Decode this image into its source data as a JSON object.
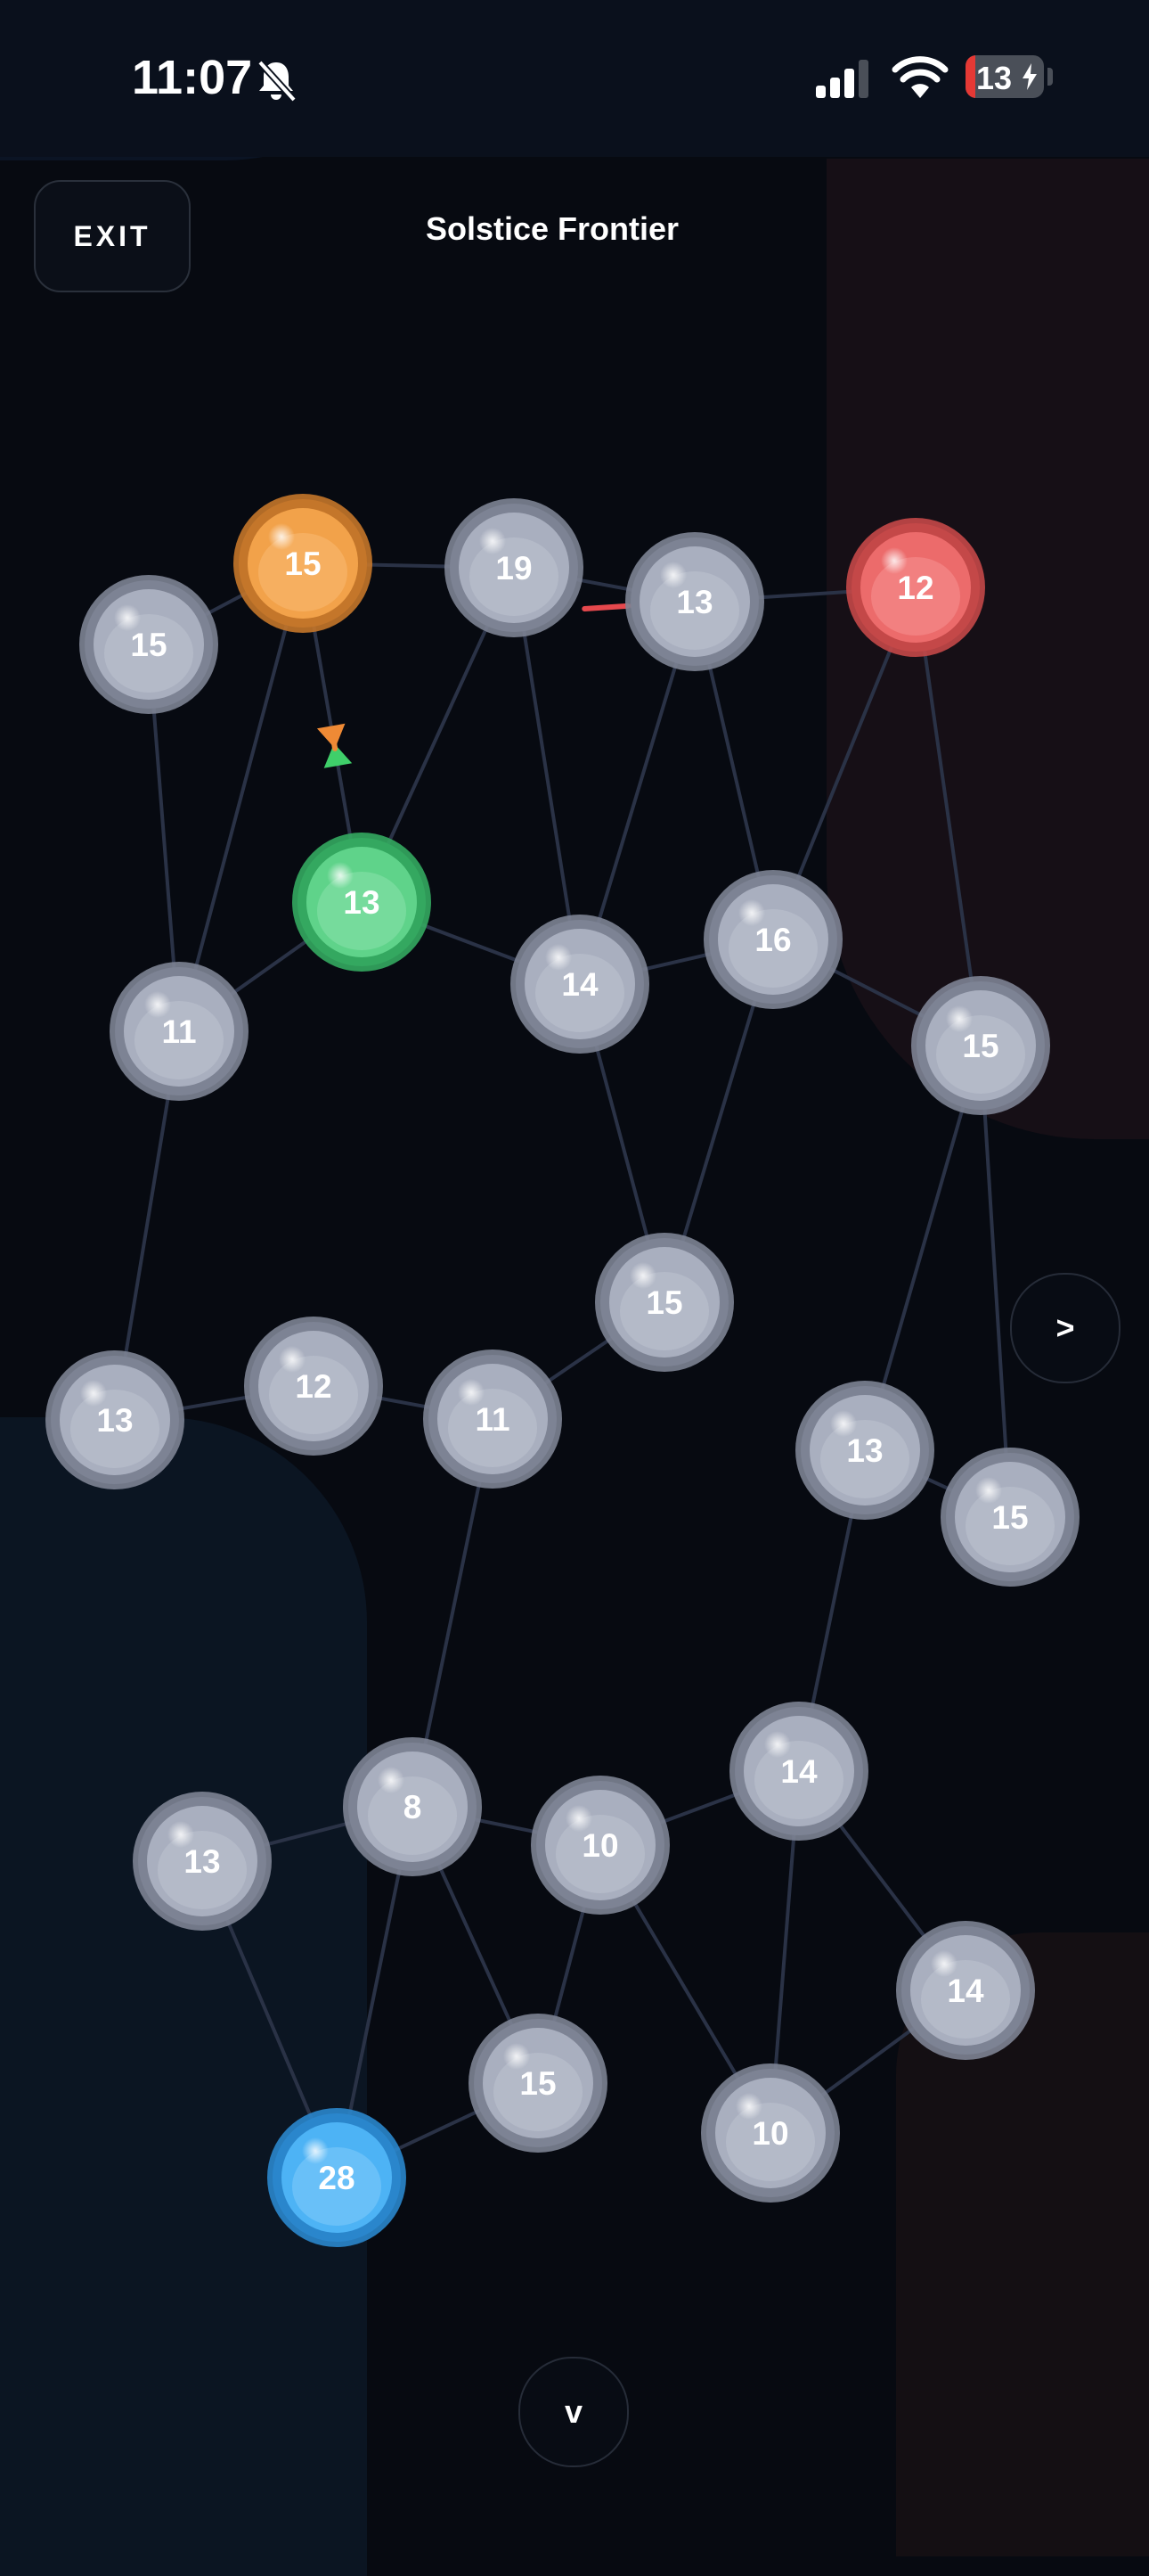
{
  "status_bar": {
    "time": "11:07",
    "battery": "13",
    "battery_level": 0.13
  },
  "header": {
    "exit_label": "EXIT",
    "title": "Solstice Frontier"
  },
  "controls": {
    "next_label": ">",
    "down_label": "v"
  },
  "colors": {
    "background": "#070a11",
    "neutral_node": "#a9afbf",
    "orange_node": "#f2a24a",
    "green_node": "#5fd38a",
    "red_node": "#ec6b6b",
    "blue_node": "#4db3f5",
    "edge": "#2a3246",
    "arrow_red": "#e5484d",
    "arrow_green": "#3fcf6a",
    "arrow_orange": "#ef8a35"
  },
  "board": {
    "nodes": [
      {
        "id": "n1",
        "value": "15",
        "owner": "orange"
      },
      {
        "id": "n2",
        "value": "19",
        "owner": "neutral"
      },
      {
        "id": "n3",
        "value": "13",
        "owner": "neutral"
      },
      {
        "id": "n4",
        "value": "12",
        "owner": "red"
      },
      {
        "id": "n5",
        "value": "15",
        "owner": "neutral"
      },
      {
        "id": "n6",
        "value": "13",
        "owner": "green"
      },
      {
        "id": "n7",
        "value": "11",
        "owner": "neutral"
      },
      {
        "id": "n8",
        "value": "14",
        "owner": "neutral"
      },
      {
        "id": "n9",
        "value": "16",
        "owner": "neutral"
      },
      {
        "id": "n10",
        "value": "15",
        "owner": "neutral"
      },
      {
        "id": "n11",
        "value": "15",
        "owner": "neutral"
      },
      {
        "id": "n12",
        "value": "13",
        "owner": "neutral"
      },
      {
        "id": "n13",
        "value": "12",
        "owner": "neutral"
      },
      {
        "id": "n14",
        "value": "11",
        "owner": "neutral"
      },
      {
        "id": "n15",
        "value": "13",
        "owner": "neutral"
      },
      {
        "id": "n16",
        "value": "15",
        "owner": "neutral"
      },
      {
        "id": "n17",
        "value": "14",
        "owner": "neutral"
      },
      {
        "id": "n18",
        "value": "8",
        "owner": "neutral"
      },
      {
        "id": "n19",
        "value": "13",
        "owner": "neutral"
      },
      {
        "id": "n20",
        "value": "10",
        "owner": "neutral"
      },
      {
        "id": "n21",
        "value": "14",
        "owner": "neutral"
      },
      {
        "id": "n22",
        "value": "15",
        "owner": "neutral"
      },
      {
        "id": "n23",
        "value": "10",
        "owner": "neutral"
      },
      {
        "id": "n24",
        "value": "28",
        "owner": "blue"
      }
    ],
    "edges": [
      [
        "n5",
        "n1"
      ],
      [
        "n1",
        "n2"
      ],
      [
        "n2",
        "n3"
      ],
      [
        "n3",
        "n4"
      ],
      [
        "n1",
        "n7"
      ],
      [
        "n1",
        "n6"
      ],
      [
        "n5",
        "n7"
      ],
      [
        "n2",
        "n6"
      ],
      [
        "n2",
        "n8"
      ],
      [
        "n3",
        "n8"
      ],
      [
        "n3",
        "n9"
      ],
      [
        "n4",
        "n9"
      ],
      [
        "n4",
        "n10"
      ],
      [
        "n6",
        "n7"
      ],
      [
        "n6",
        "n8"
      ],
      [
        "n8",
        "n9"
      ],
      [
        "n9",
        "n10"
      ],
      [
        "n8",
        "n11"
      ],
      [
        "n9",
        "n11"
      ],
      [
        "n7",
        "n12"
      ],
      [
        "n12",
        "n13"
      ],
      [
        "n13",
        "n14"
      ],
      [
        "n14",
        "n11"
      ],
      [
        "n10",
        "n15"
      ],
      [
        "n10",
        "n16"
      ],
      [
        "n15",
        "n16"
      ],
      [
        "n15",
        "n17"
      ],
      [
        "n14",
        "n18"
      ],
      [
        "n18",
        "n19"
      ],
      [
        "n18",
        "n20"
      ],
      [
        "n18",
        "n22"
      ],
      [
        "n18",
        "n24"
      ],
      [
        "n19",
        "n24"
      ],
      [
        "n20",
        "n22"
      ],
      [
        "n20",
        "n17"
      ],
      [
        "n20",
        "n23"
      ],
      [
        "n17",
        "n23"
      ],
      [
        "n17",
        "n21"
      ],
      [
        "n21",
        "n23"
      ],
      [
        "n22",
        "n24"
      ]
    ],
    "attacks": [
      {
        "from": "n4",
        "to": "n3",
        "owner": "red"
      },
      {
        "from": "n6",
        "to": "n1",
        "owner": "green"
      },
      {
        "from": "n1",
        "to": "n6",
        "owner": "orange"
      }
    ]
  }
}
